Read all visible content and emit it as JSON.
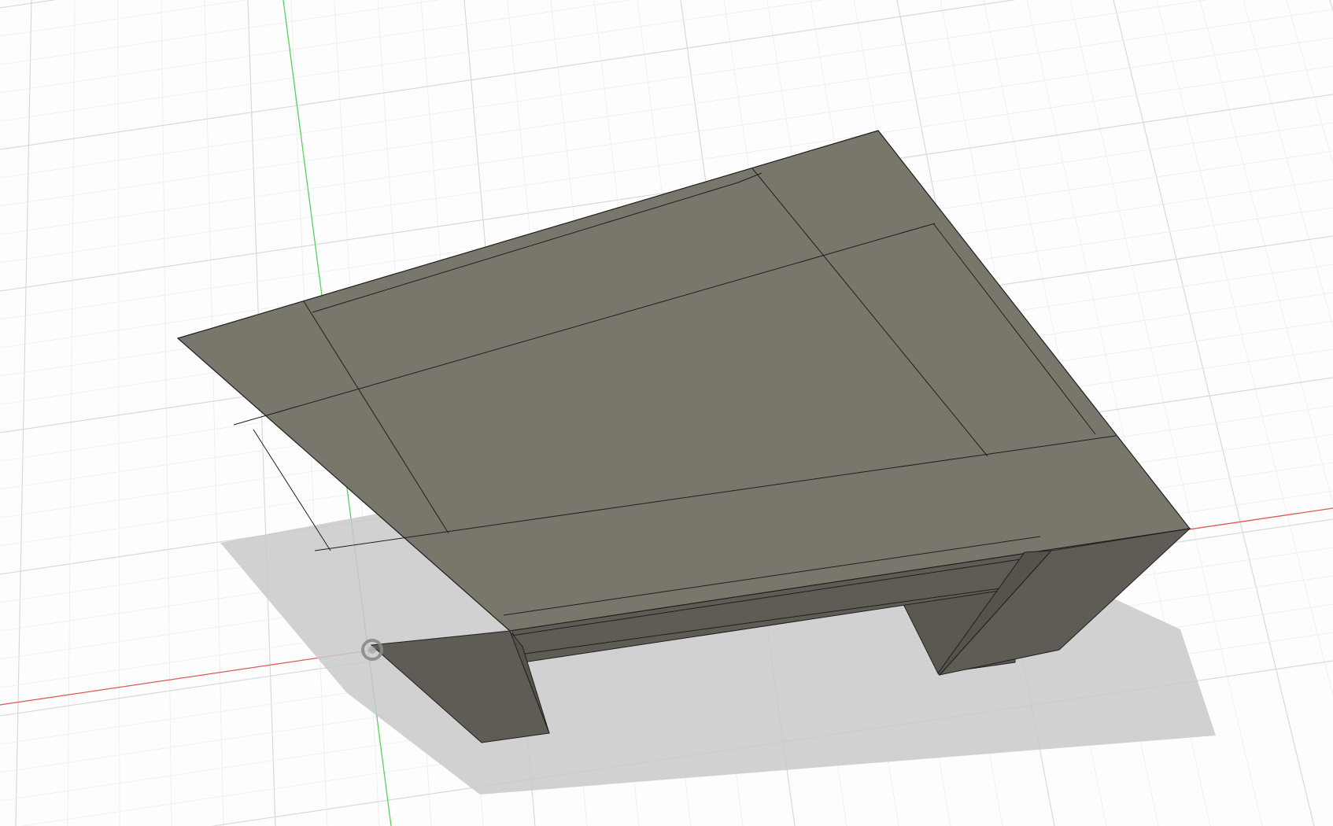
{
  "app": {
    "view": "3d-viewport",
    "background_color": "#fdfdfd"
  },
  "colors": {
    "grid_major": "#d6d6d6",
    "grid_minor": "#ececec",
    "axis_x": "#e05656",
    "axis_y": "#5bd15b",
    "shadow": "#c9c9c9",
    "top_face": "#79766c",
    "front_face": "#6a675e",
    "leg_face": "#5f5c55",
    "leg_face_dark": "#55534c",
    "edge": "#1f1f1f",
    "origin_marker": "#8a8a8a"
  },
  "model": {
    "object": "table",
    "component_count": 5,
    "parts": [
      "tabletop",
      "apron-front",
      "leg-front-left",
      "leg-front-right",
      "leg-back-right"
    ]
  },
  "icons": {
    "origin": "origin-icon"
  }
}
